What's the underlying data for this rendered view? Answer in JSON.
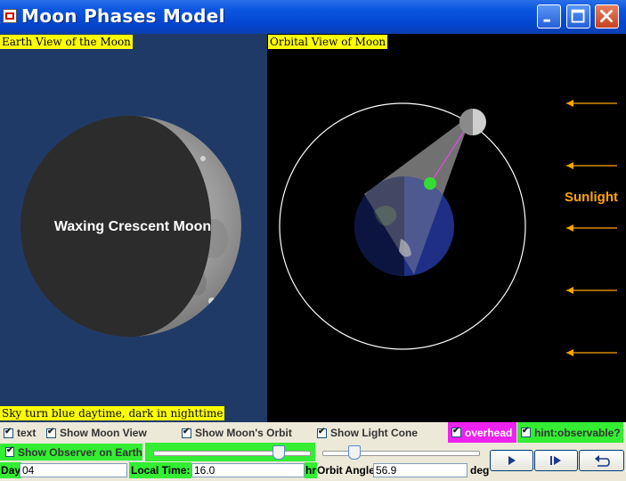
{
  "window": {
    "title": "Moon Phases Model",
    "buttons": [
      "minimize",
      "maximize",
      "close"
    ]
  },
  "earth_view": {
    "label": "Earth View of the Moon",
    "phase_text": "Waxing Crescent Moon",
    "footer": "Sky turn blue daytime, dark in nighttime",
    "sky_color": "#203a68"
  },
  "orbital_view": {
    "label": "Orbital View of Moon",
    "sunlight_label": "Sunlight",
    "arrow_color": "#ffa500"
  },
  "controls": {
    "text_cb": "text",
    "show_moon_view": "Show Moon View",
    "show_moon_orbit": "Show Moon's Orbit",
    "show_light_cone": "Show Light Cone",
    "overhead": "overhead",
    "hint": "hint:observable?",
    "show_observer": "Show Observer on Earth",
    "day_label": "Day",
    "day_value": "04",
    "local_time_label": "Local Time:",
    "local_time_value": "16.0",
    "local_time_unit": "hr",
    "orbit_angle_label": "Orbit Angle",
    "orbit_angle_value": "56.9",
    "orbit_angle_unit": "deg",
    "local_time_slider": 0.8,
    "orbit_angle_slider": 0.2
  },
  "icons": [
    "app-icon",
    "minimize-icon",
    "maximize-icon",
    "close-icon",
    "play-icon",
    "step-icon",
    "reset-icon",
    "sunlight-arrow-icon"
  ]
}
